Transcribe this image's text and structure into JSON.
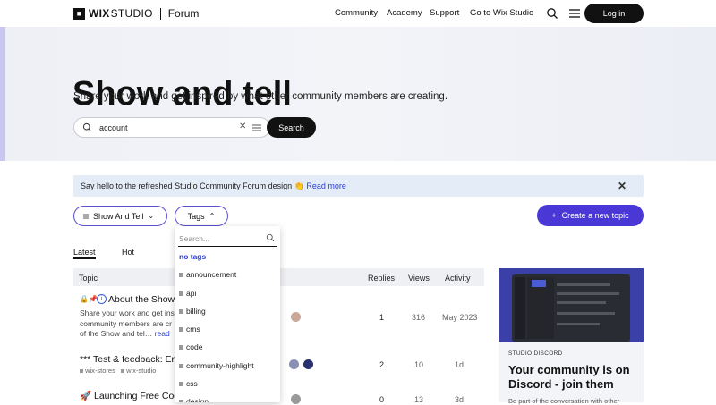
{
  "header": {
    "logo_brand": "WIX",
    "logo_studio": "STUDIO",
    "logo_forum": "Forum",
    "nav": [
      "Community",
      "Academy",
      "Support",
      "Go to Wix Studio"
    ],
    "login": "Log in"
  },
  "hero": {
    "title": "Show and tell",
    "subtitle": "Share your work and get inspired by what other community members are creating.",
    "search_value": "account",
    "search_button": "Search"
  },
  "banner": {
    "text": "Say hello to the refreshed Studio Community Forum design 👏",
    "link": "Read more"
  },
  "filters": {
    "category": "Show And Tell",
    "tags": "Tags",
    "create": "Create a new topic"
  },
  "tabs": [
    "Latest",
    "Hot"
  ],
  "table": {
    "headers": [
      "Topic",
      "Replies",
      "Views",
      "Activity"
    ],
    "rows": [
      {
        "title": "About the Show",
        "excerpt": "Share your work and get ins community members are cr of the Show and tel…",
        "read": "read",
        "replies": "1",
        "views": "316",
        "activity": "May 2023"
      },
      {
        "title": "*** Test & feedback: Eme",
        "tags": [
          "wix-stores",
          "wix-studio"
        ],
        "replies": "2",
        "views": "10",
        "activity": "1d"
      },
      {
        "title": "🚀 Launching Free Code",
        "replies": "0",
        "views": "13",
        "activity": "3d"
      }
    ]
  },
  "dropdown": {
    "placeholder": "Search...",
    "items": [
      "no tags",
      "announcement",
      "api",
      "billing",
      "cms",
      "code",
      "community-highlight",
      "css",
      "design"
    ]
  },
  "side": {
    "eyebrow": "STUDIO DISCORD",
    "title": "Your community is on Discord - join them",
    "body": "Be part of the conversation with other"
  }
}
